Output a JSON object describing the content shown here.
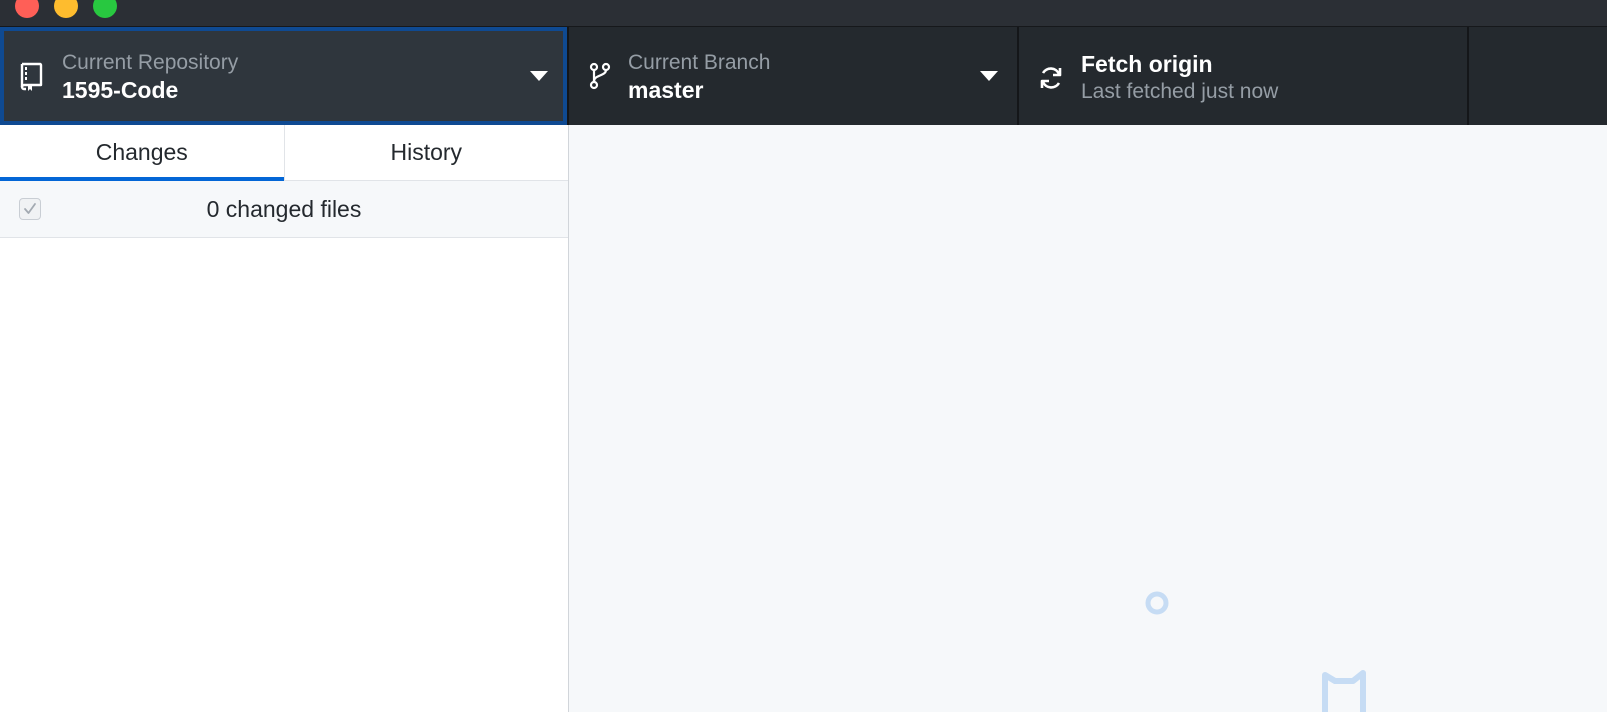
{
  "window": {
    "controls": [
      "close",
      "minimize",
      "maximize"
    ]
  },
  "toolbar": {
    "repository": {
      "label": "Current Repository",
      "value": "1595-Code",
      "icon": "repo-icon"
    },
    "branch": {
      "label": "Current Branch",
      "value": "master",
      "icon": "branch-icon"
    },
    "fetch": {
      "title": "Fetch origin",
      "subtitle": "Last fetched just now",
      "icon": "sync-icon"
    }
  },
  "sidebar": {
    "tabs": [
      {
        "label": "Changes",
        "active": true
      },
      {
        "label": "History",
        "active": false
      }
    ],
    "changes_summary": "0 changed files",
    "select_all_checked": true
  },
  "colors": {
    "toolbar_bg": "#24292e",
    "toolbar_selected_bg": "#2f363d",
    "focus_ring": "#0f4a92",
    "tab_active_underline": "#0366d6",
    "main_bg": "#f6f8fa",
    "illustration": "#c6dcf4"
  }
}
